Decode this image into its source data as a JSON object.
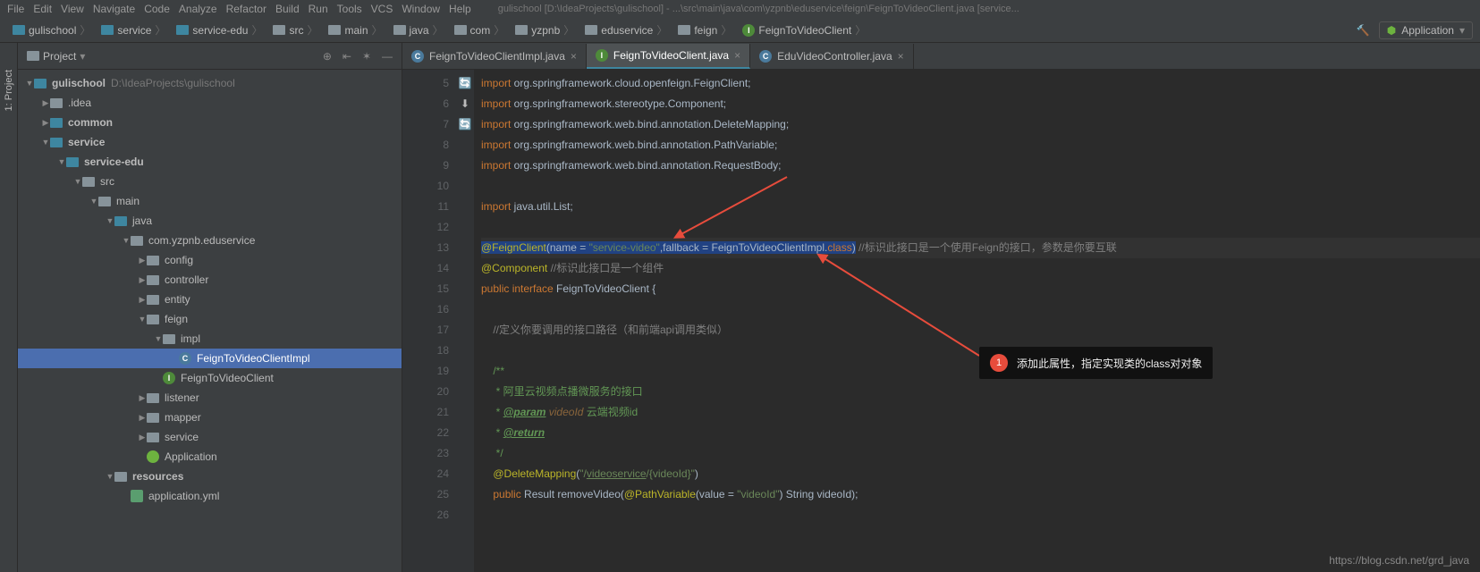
{
  "menu": {
    "file": "File",
    "edit": "Edit",
    "view": "View",
    "navigate": "Navigate",
    "code": "Code",
    "analyze": "Analyze",
    "refactor": "Refactor",
    "build": "Build",
    "run": "Run",
    "tools": "Tools",
    "vcs": "VCS",
    "window": "Window",
    "help": "Help"
  },
  "title": "gulischool [D:\\IdeaProjects\\gulischool] - ...\\src\\main\\java\\com\\yzpnb\\eduservice\\feign\\FeignToVideoClient.java [service...",
  "breadcrumbs": [
    "gulischool",
    "service",
    "service-edu",
    "src",
    "main",
    "java",
    "com",
    "yzpnb",
    "eduservice",
    "feign",
    "FeignToVideoClient"
  ],
  "runConfig": "Application",
  "projectPanel": {
    "title": "Project"
  },
  "tree": {
    "root": {
      "name": "gulischool",
      "path": "D:\\IdeaProjects\\gulischool"
    },
    "idea": ".idea",
    "common": "common",
    "service": "service",
    "serviceEdu": "service-edu",
    "src": "src",
    "main": "main",
    "java": "java",
    "pkg": "com.yzpnb.eduservice",
    "config": "config",
    "controller": "controller",
    "entity": "entity",
    "feign": "feign",
    "impl": "impl",
    "feignImplClass": "FeignToVideoClientImpl",
    "feignClient": "FeignToVideoClient",
    "listener": "listener",
    "mapper": "mapper",
    "servicePkg": "service",
    "application": "Application",
    "resources": "resources",
    "appYml": "application.yml"
  },
  "tabs": [
    {
      "label": "FeignToVideoClientImpl.java",
      "icon": "C"
    },
    {
      "label": "FeignToVideoClient.java",
      "icon": "I",
      "active": true
    },
    {
      "label": "EduVideoController.java",
      "icon": "C"
    }
  ],
  "code": {
    "startLine": 5,
    "lines": [
      {
        "n": 5,
        "html": "<span class='kw'>import</span> org.springframework.cloud.openfeign.FeignClient;"
      },
      {
        "n": 6,
        "html": "<span class='kw'>import</span> org.springframework.stereotype.Component;"
      },
      {
        "n": 7,
        "html": "<span class='kw'>import</span> org.springframework.web.bind.annotation.DeleteMapping;"
      },
      {
        "n": 8,
        "html": "<span class='kw'>import</span> org.springframework.web.bind.annotation.PathVariable;"
      },
      {
        "n": 9,
        "html": "<span class='kw'>import</span> org.springframework.web.bind.annotation.RequestBody;"
      },
      {
        "n": 10,
        "html": ""
      },
      {
        "n": 11,
        "html": "<span class='kw'>import</span> java.util.List;"
      },
      {
        "n": 12,
        "html": ""
      },
      {
        "n": 13,
        "html": "<span class='hl'><span class='ann'>@FeignClient</span>(name = <span class='str'>\"service-video\"</span>,fallback = FeignToVideoClientImpl.<span class='kw'>class</span>)</span> <span class='cmt'>//标识此接口是一个使用Feign的接口，参数是你要互联</span>"
      },
      {
        "n": 14,
        "html": "<span class='ann'>@Component</span> <span class='cmt'>//标识此接口是一个组件</span>",
        "gut": "🔄"
      },
      {
        "n": 15,
        "html": "<span class='kw'>public interface</span> FeignToVideoClient {",
        "gut": "⬇"
      },
      {
        "n": 16,
        "html": ""
      },
      {
        "n": 17,
        "html": "    <span class='cmt'>//定义你要调用的接口路径（和前端api调用类似）</span>"
      },
      {
        "n": 18,
        "html": ""
      },
      {
        "n": 19,
        "html": "    <span class='doc'>/**</span>"
      },
      {
        "n": 20,
        "html": "    <span class='doc'> * 阿里云视频点播微服务的接口</span>"
      },
      {
        "n": 21,
        "html": "    <span class='doc'> * <span class='doctag'>@param</span> <span class='param'>videoId</span> 云端视频id</span>"
      },
      {
        "n": 22,
        "html": "    <span class='doc'> * <span class='doctag'>@return</span></span>"
      },
      {
        "n": 23,
        "html": "    <span class='doc'> */</span>"
      },
      {
        "n": 24,
        "html": "    <span class='ann'>@DeleteMapping</span>(<span class='str'>\"/<u>videoservice</u>/{videoId}\"</span>)"
      },
      {
        "n": 25,
        "html": "    <span class='kw'>public</span> Result removeVideo(<span class='ann'>@PathVariable</span>(value = <span class='str'>\"videoId\"</span>) String videoId);",
        "gut": "🔄"
      },
      {
        "n": 26,
        "html": ""
      }
    ]
  },
  "callout": {
    "num": "1",
    "text": "添加此属性，指定实现类的class对对象"
  },
  "watermark": "https://blog.csdn.net/grd_java",
  "sidebarTab": "1: Project"
}
